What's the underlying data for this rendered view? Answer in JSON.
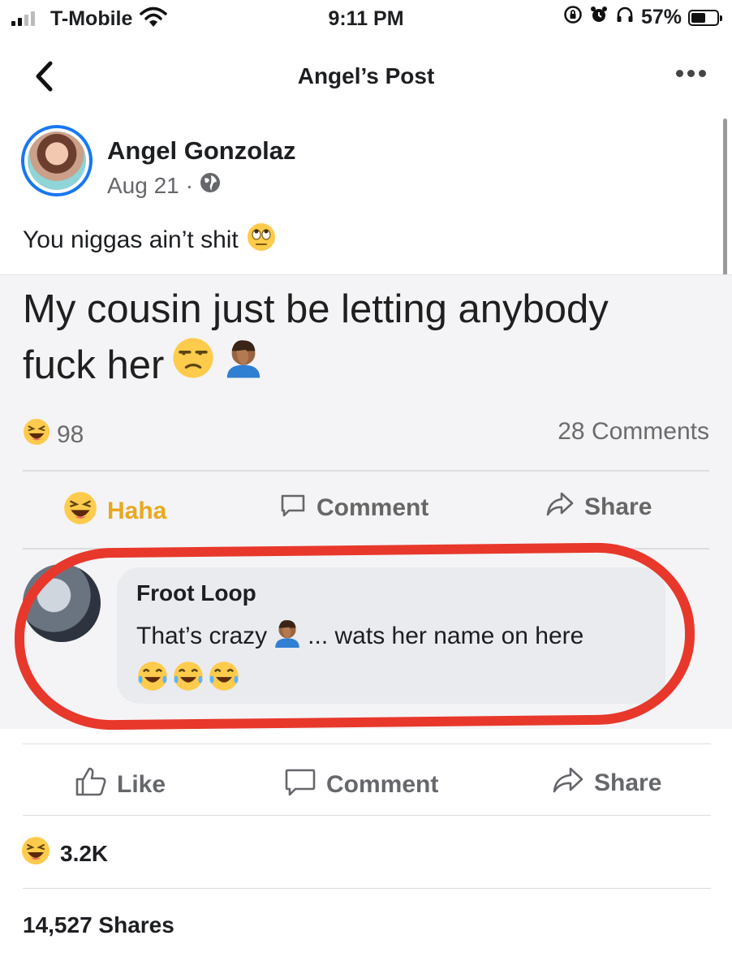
{
  "status_bar": {
    "carrier": "T-Mobile",
    "time": "9:11 PM",
    "battery": "57%",
    "battery_level": 0.57
  },
  "nav": {
    "title": "Angel’s Post"
  },
  "post": {
    "author": "Angel Gonzolaz",
    "date": "Aug 21",
    "separator": "·",
    "caption": "You niggas ain’t shit",
    "shared_image": {
      "text_line1": "My cousin just be letting anybody",
      "text_line2": "fuck her",
      "reaction_count": "98",
      "comments_count": "28 Comments",
      "actions": {
        "haha": "Haha",
        "comment": "Comment",
        "share": "Share"
      },
      "comment": {
        "name": "Froot Loop",
        "text_before": "That’s crazy",
        "text_after": "... wats her name on here"
      }
    },
    "actions": {
      "like": "Like",
      "comment": "Comment",
      "share": "Share"
    },
    "reactions": "3.2K",
    "shares": "14,527 Shares"
  },
  "colors": {
    "accent": "#1877f2",
    "annotation_red": "#e8382b",
    "emoji_yellow": "#ffcb4c"
  }
}
